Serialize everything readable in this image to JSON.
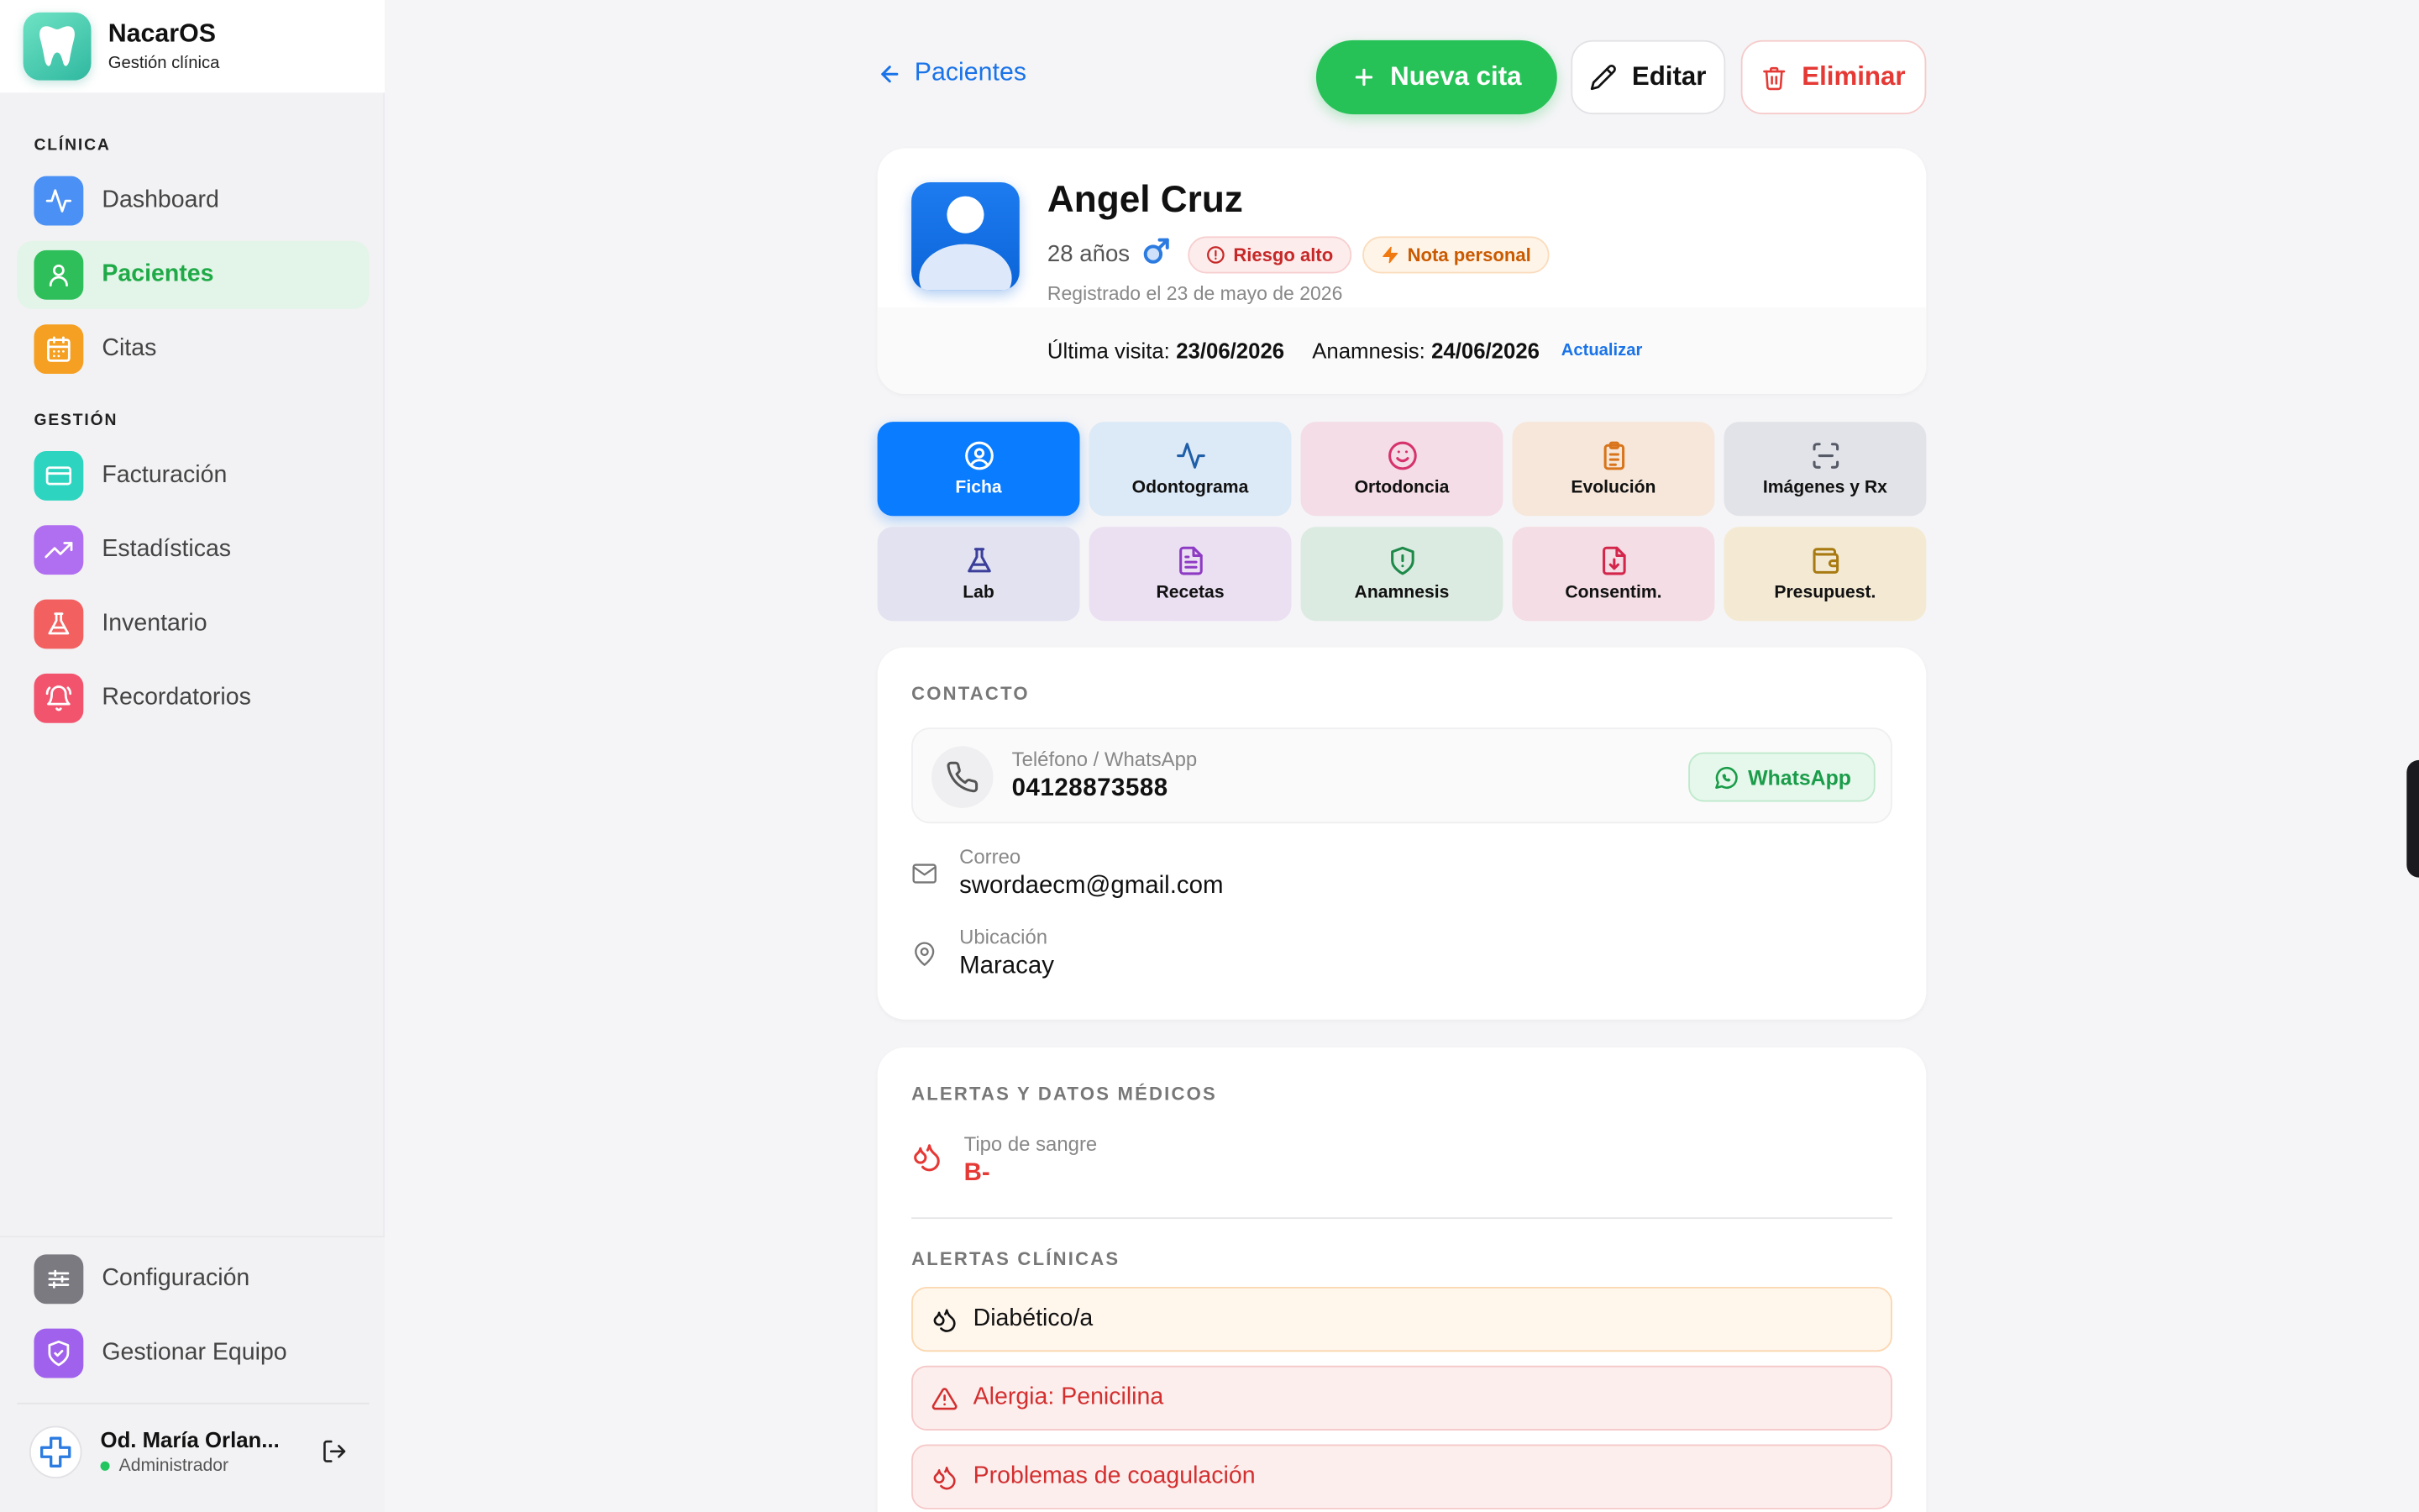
{
  "brand": {
    "name": "NacarOS",
    "subtitle": "Gestión clínica"
  },
  "sidebar": {
    "sections": [
      {
        "label": "CLÍNICA"
      },
      {
        "label": "GESTIÓN"
      }
    ],
    "items": [
      {
        "label": "Dashboard",
        "icon": "activity-icon",
        "color": "#4a90f5"
      },
      {
        "label": "Pacientes",
        "icon": "user-icon",
        "color": "#2fbf5a",
        "active": true
      },
      {
        "label": "Citas",
        "icon": "calendar-icon",
        "color": "#f5a023"
      },
      {
        "label": "Facturación",
        "icon": "credit-card-icon",
        "color": "#2dd4bf"
      },
      {
        "label": "Estadísticas",
        "icon": "trending-up-icon",
        "color": "#b06ef0"
      },
      {
        "label": "Inventario",
        "icon": "flask-icon",
        "color": "#f26060"
      },
      {
        "label": "Recordatorios",
        "icon": "bell-icon",
        "color": "#f2546e"
      }
    ],
    "bottom_items": [
      {
        "label": "Configuración",
        "icon": "sliders-icon",
        "color": "#7a7a80"
      },
      {
        "label": "Gestionar Equipo",
        "icon": "shield-icon",
        "color": "#a061ec"
      }
    ],
    "user": {
      "name": "Od. María Orlan...",
      "role": "Administrador"
    }
  },
  "header": {
    "back_label": "Pacientes",
    "new_button": "Nueva cita",
    "edit_button": "Editar",
    "delete_button": "Eliminar"
  },
  "patient": {
    "name": "Angel Cruz",
    "age": "28 años",
    "risk_badge": "Riesgo alto",
    "note_badge": "Nota personal",
    "registered": "Registrado el 23 de mayo de 2026",
    "last_visit_label": "Última visita:",
    "last_visit_value": "23/06/2026",
    "anamnesis_label": "Anamnesis:",
    "anamnesis_value": "24/06/2026",
    "update_link": "Actualizar"
  },
  "tabs": [
    {
      "label": "Ficha",
      "icon": "user-circle-icon",
      "bg": "#0a7cff",
      "fg": "#ffffff",
      "active": true
    },
    {
      "label": "Odontograma",
      "icon": "activity-icon",
      "bg": "#dce9f6",
      "fg": "#1f5fa8"
    },
    {
      "label": "Ortodoncia",
      "icon": "smile-icon",
      "bg": "#f4dde6",
      "fg": "#d6336c"
    },
    {
      "label": "Evolución",
      "icon": "clipboard-icon",
      "bg": "#f6e7da",
      "fg": "#d9741a"
    },
    {
      "label": "Imágenes y Rx",
      "icon": "scan-icon",
      "bg": "#e2e3e8",
      "fg": "#555a66"
    },
    {
      "label": "Lab",
      "icon": "flask-icon",
      "bg": "#e2e2f1",
      "fg": "#3b3f9a"
    },
    {
      "label": "Recetas",
      "icon": "file-text-icon",
      "bg": "#ebe0f2",
      "fg": "#8e3bc4"
    },
    {
      "label": "Anamnesis",
      "icon": "shield-alert-icon",
      "bg": "#dcebe1",
      "fg": "#1e8a4a"
    },
    {
      "label": "Consentim.",
      "icon": "file-down-icon",
      "bg": "#f4dde4",
      "fg": "#d3264a"
    },
    {
      "label": "Presupuest.",
      "icon": "wallet-icon",
      "bg": "#f4ead4",
      "fg": "#a87a12"
    }
  ],
  "contact": {
    "title": "CONTACTO",
    "phone_label": "Teléfono / WhatsApp",
    "phone_value": "04128873588",
    "whatsapp_button": "WhatsApp",
    "email_label": "Correo",
    "email_value": "swordaecm@gmail.com",
    "location_label": "Ubicación",
    "location_value": "Maracay"
  },
  "medical": {
    "title": "ALERTAS Y DATOS MÉDICOS",
    "blood_label": "Tipo de sangre",
    "blood_value": "B-",
    "clinical_title": "ALERTAS CLÍNICAS",
    "alerts": [
      {
        "label": "Diabético/a",
        "level": "warning"
      },
      {
        "label": "Alergia: Penicilina",
        "level": "danger"
      },
      {
        "label": "Problemas de coagulación",
        "level": "danger"
      }
    ]
  }
}
